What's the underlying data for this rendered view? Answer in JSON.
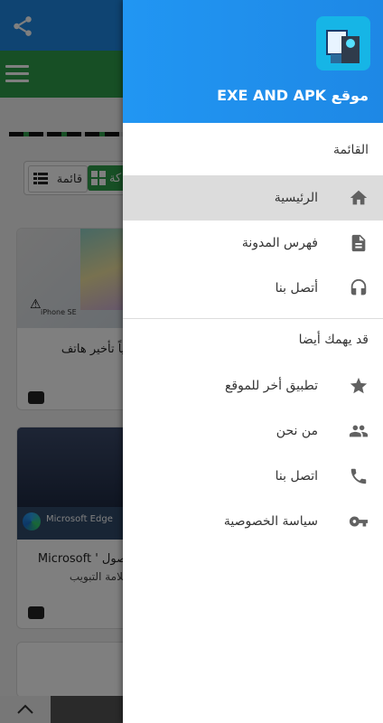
{
  "background": {
    "view_toggle": {
      "list_label": "قائمة",
      "grid_label": "كة"
    },
    "card1": {
      "title": "سمياً تأخير هاتف",
      "caption": "iPhone SE"
    },
    "card2": {
      "title": "Microsoft ' للحصول",
      "subtitle": "بة علامة التبويب",
      "banner": "Microsoft Edge"
    }
  },
  "drawer": {
    "site_title": "موقع EXE AND APK",
    "menu_section_label": "القائمة",
    "menu_items": [
      {
        "label": "الرئيسية",
        "icon": "home-icon",
        "active": true
      },
      {
        "label": "فهرس المدونة",
        "icon": "document-icon",
        "active": false
      },
      {
        "label": "أتصل بنا",
        "icon": "headset-icon",
        "active": false
      }
    ],
    "extra_section_label": "قد يهمك أيضا",
    "extra_items": [
      {
        "label": "تطبيق أخر للموقع",
        "icon": "star-icon"
      },
      {
        "label": "من نحن",
        "icon": "people-icon"
      },
      {
        "label": "اتصل بنا",
        "icon": "phone-icon"
      },
      {
        "label": "سياسة الخصوصية",
        "icon": "key-icon"
      }
    ]
  },
  "colors": {
    "header_blue": "#1e88e5",
    "accent_green": "#2e9e4a",
    "icon_gray": "#616161"
  }
}
